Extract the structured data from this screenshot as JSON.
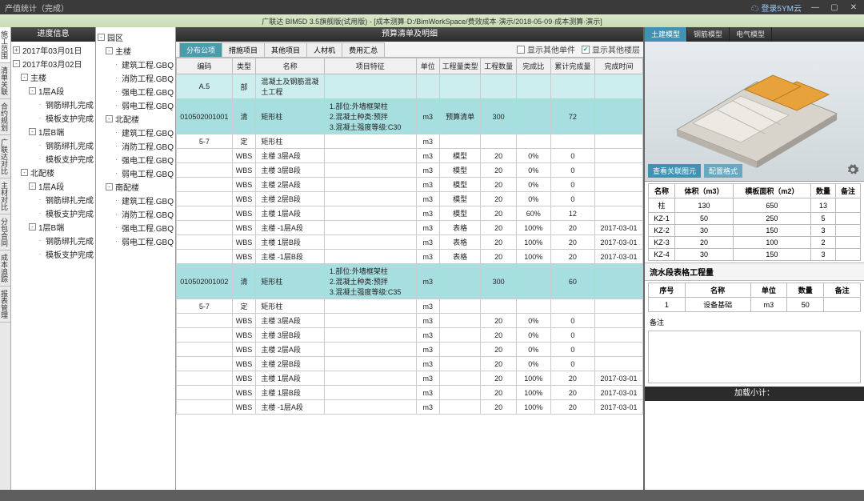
{
  "titlebar": {
    "title": "产值统计（完成）",
    "cloud": "登录5YM云"
  },
  "subbar": "广联达 BIM5D 3.5旗舰版(试用版) - [成本测算·D:/BimWorkSpace/费效成本·演示/2018-05-09·成本测算·演示]",
  "left_vtabs": [
    "施工范围",
    "清单关联",
    "合约规划",
    "广联达对比",
    "主材对比",
    "分包合同",
    "成本追踪",
    "报表管理"
  ],
  "panel_headers": {
    "progress": "进度信息",
    "zone": "园区",
    "center": "预算清单及明细"
  },
  "progress_tree": [
    {
      "l": 0,
      "t": "2017年03月01日",
      "e": "+"
    },
    {
      "l": 0,
      "t": "2017年03月02日",
      "e": "-"
    },
    {
      "l": 1,
      "t": "主楼",
      "e": "-"
    },
    {
      "l": 2,
      "t": "1层A段",
      "e": "-"
    },
    {
      "l": 3,
      "t": "钢筋绑扎完成"
    },
    {
      "l": 3,
      "t": "模板支护完成"
    },
    {
      "l": 2,
      "t": "1层B端",
      "e": "-"
    },
    {
      "l": 3,
      "t": "钢筋绑扎完成"
    },
    {
      "l": 3,
      "t": "模板支护完成"
    },
    {
      "l": 1,
      "t": "北配楼",
      "e": "-"
    },
    {
      "l": 2,
      "t": "1层A段",
      "e": "-"
    },
    {
      "l": 3,
      "t": "钢筋绑扎完成"
    },
    {
      "l": 3,
      "t": "模板支护完成"
    },
    {
      "l": 2,
      "t": "1层B端",
      "e": "-"
    },
    {
      "l": 3,
      "t": "钢筋绑扎完成"
    },
    {
      "l": 3,
      "t": "模板支护完成"
    }
  ],
  "zone_tree": [
    {
      "l": 0,
      "t": "园区",
      "e": "-"
    },
    {
      "l": 1,
      "t": "主楼",
      "e": "-"
    },
    {
      "l": 2,
      "t": "建筑工程.GBQ"
    },
    {
      "l": 2,
      "t": "消防工程.GBQ"
    },
    {
      "l": 2,
      "t": "强电工程.GBQ"
    },
    {
      "l": 2,
      "t": "弱电工程.GBQ"
    },
    {
      "l": 1,
      "t": "北配楼",
      "e": "-"
    },
    {
      "l": 2,
      "t": "建筑工程.GBQ"
    },
    {
      "l": 2,
      "t": "消防工程.GBQ"
    },
    {
      "l": 2,
      "t": "强电工程.GBQ"
    },
    {
      "l": 2,
      "t": "弱电工程.GBQ"
    },
    {
      "l": 1,
      "t": "南配楼",
      "e": "-"
    },
    {
      "l": 2,
      "t": "建筑工程.GBQ"
    },
    {
      "l": 2,
      "t": "消防工程.GBQ"
    },
    {
      "l": 2,
      "t": "强电工程.GBQ"
    },
    {
      "l": 2,
      "t": "弱电工程.GBQ"
    }
  ],
  "center_tabs": [
    "分布公项",
    "措施项目",
    "其他项目",
    "人材机",
    "费用汇总"
  ],
  "center_checks": {
    "a": "显示其他单件",
    "b": "显示其他楼层"
  },
  "grid_cols": [
    "编码",
    "类型",
    "名称",
    "项目特征",
    "单位",
    "工程量类型",
    "工程数量",
    "完成比",
    "累计完成量",
    "完成时间"
  ],
  "grid_rows": [
    {
      "hl": "hl2",
      "c": [
        "A.5",
        "部",
        "混凝土及钢筋混凝土工程",
        "",
        "",
        "",
        "",
        "",
        "",
        ""
      ]
    },
    {
      "hl": "hl",
      "c": [
        "010502001001",
        "清",
        "矩形柱",
        "1.部位:外墙框架柱\n2.混凝土种类:预拌\n3.混凝土强度等级:C30",
        "m3",
        "预算清单",
        "300",
        "",
        "72",
        ""
      ]
    },
    {
      "c": [
        "5-7",
        "定",
        "矩形柱",
        "",
        "m3",
        "",
        "",
        "",
        "",
        ""
      ]
    },
    {
      "c": [
        "",
        "WBS",
        "主楼  3层A段",
        "",
        "m3",
        "模型",
        "20",
        "0%",
        "0",
        ""
      ]
    },
    {
      "c": [
        "",
        "WBS",
        "主楼  3层B段",
        "",
        "m3",
        "模型",
        "20",
        "0%",
        "0",
        ""
      ]
    },
    {
      "c": [
        "",
        "WBS",
        "主楼  2层A段",
        "",
        "m3",
        "模型",
        "20",
        "0%",
        "0",
        ""
      ]
    },
    {
      "c": [
        "",
        "WBS",
        "主楼  2层B段",
        "",
        "m3",
        "模型",
        "20",
        "0%",
        "0",
        ""
      ]
    },
    {
      "c": [
        "",
        "WBS",
        "主楼  1层A段",
        "",
        "m3",
        "模型",
        "20",
        "60%",
        "12",
        ""
      ]
    },
    {
      "c": [
        "",
        "WBS",
        "主楼 -1层A段",
        "",
        "m3",
        "表格",
        "20",
        "100%",
        "20",
        "2017-03-01"
      ]
    },
    {
      "c": [
        "",
        "WBS",
        "主楼  1层B段",
        "",
        "m3",
        "表格",
        "20",
        "100%",
        "20",
        "2017-03-01"
      ]
    },
    {
      "c": [
        "",
        "WBS",
        "主楼 -1层B段",
        "",
        "m3",
        "表格",
        "20",
        "100%",
        "20",
        "2017-03-01"
      ]
    },
    {
      "hl": "hl",
      "c": [
        "010502001002",
        "清",
        "矩形柱",
        "1.部位:外墙框架柱\n2.混凝土种类:预拌\n3.混凝土强度等级:C35",
        "m3",
        "",
        "300",
        "",
        "60",
        ""
      ]
    },
    {
      "c": [
        "5-7",
        "定",
        "矩形柱",
        "",
        "m3",
        "",
        "",
        "",
        "",
        ""
      ]
    },
    {
      "c": [
        "",
        "WBS",
        "主楼  3层A段",
        "",
        "m3",
        "",
        "20",
        "0%",
        "0",
        ""
      ]
    },
    {
      "c": [
        "",
        "WBS",
        "主楼  3层B段",
        "",
        "m3",
        "",
        "20",
        "0%",
        "0",
        ""
      ]
    },
    {
      "c": [
        "",
        "WBS",
        "主楼  2层A段",
        "",
        "m3",
        "",
        "20",
        "0%",
        "0",
        ""
      ]
    },
    {
      "c": [
        "",
        "WBS",
        "主楼  2层B段",
        "",
        "m3",
        "",
        "20",
        "0%",
        "0",
        ""
      ]
    },
    {
      "c": [
        "",
        "WBS",
        "主楼  1层A段",
        "",
        "m3",
        "",
        "20",
        "100%",
        "20",
        "2017-03-01"
      ]
    },
    {
      "c": [
        "",
        "WBS",
        "主楼  1层B段",
        "",
        "m3",
        "",
        "20",
        "100%",
        "20",
        "2017-03-01"
      ]
    },
    {
      "c": [
        "",
        "WBS",
        "主楼 -1层A段",
        "",
        "m3",
        "",
        "20",
        "100%",
        "20",
        "2017-03-01"
      ]
    }
  ],
  "right_tabs": [
    "土建模型",
    "钢筋模型",
    "电气模型"
  ],
  "viewer_buttons": {
    "a": "查看关联图元",
    "b": "配置格式"
  },
  "rt1_cols": [
    "名称",
    "体积（m3）",
    "模板面积（m2）",
    "数量",
    "备注"
  ],
  "rt1_rows": [
    [
      "柱",
      "130",
      "650",
      "13",
      ""
    ],
    [
      "KZ-1",
      "50",
      "250",
      "5",
      ""
    ],
    [
      "KZ-2",
      "30",
      "150",
      "3",
      ""
    ],
    [
      "KZ-3",
      "20",
      "100",
      "2",
      ""
    ],
    [
      "KZ-4",
      "30",
      "150",
      "3",
      ""
    ]
  ],
  "rt2_title": "流水段表格工程量",
  "rt2_cols": [
    "序号",
    "名称",
    "单位",
    "数量",
    "备注"
  ],
  "rt2_rows": [
    [
      "1",
      "设备基础",
      "m3",
      "50",
      ""
    ]
  ],
  "remark_label": "备注",
  "footer": "加载小计："
}
